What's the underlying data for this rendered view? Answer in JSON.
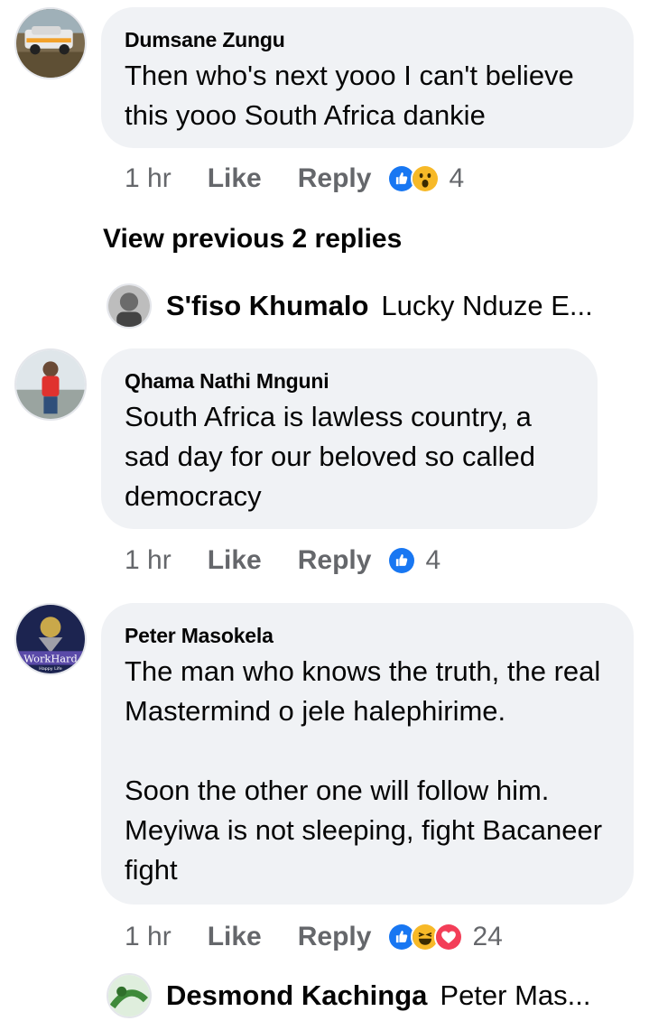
{
  "comments": [
    {
      "author": "Dumsane Zungu",
      "text": "Then who's next yooo I can't believe this yooo South Africa dankie",
      "time": "1 hr",
      "like": "Like",
      "reply": "Reply",
      "reactions": [
        "like-reaction-icon",
        "wow-reaction-icon"
      ],
      "count": "4"
    },
    {
      "author": "Qhama Nathi Mnguni",
      "text": "South Africa is lawless country, a sad day for our beloved so called democracy",
      "time": "1 hr",
      "like": "Like",
      "reply": "Reply",
      "reactions": [
        "like-reaction-icon"
      ],
      "count": "4"
    },
    {
      "author": "Peter Masokela",
      "text": "The man who knows the truth, the real Mastermind o jele halephirime.\n\nSoon the other one will follow him. Meyiwa is not sleeping, fight Bacaneer fight",
      "time": "1 hr",
      "like": "Like",
      "reply": "Reply",
      "reactions": [
        "like-reaction-icon",
        "haha-reaction-icon",
        "love-reaction-icon"
      ],
      "count": "24",
      "avatar_text": "WorkHard",
      "avatar_subtext": "Happy Life"
    }
  ],
  "view_previous": "View previous 2 replies",
  "replies": [
    {
      "name": "S'fiso Khumalo",
      "text": "Lucky Nduze E..."
    },
    {
      "name": "Desmond Kachinga",
      "text": "Peter Mas..."
    }
  ],
  "colors": {
    "bubble": "#f0f2f5",
    "like_blue": "#1877f2",
    "love_red": "#f33e58",
    "haha_yellow": "#f7b928",
    "meta_gray": "#65676b"
  }
}
